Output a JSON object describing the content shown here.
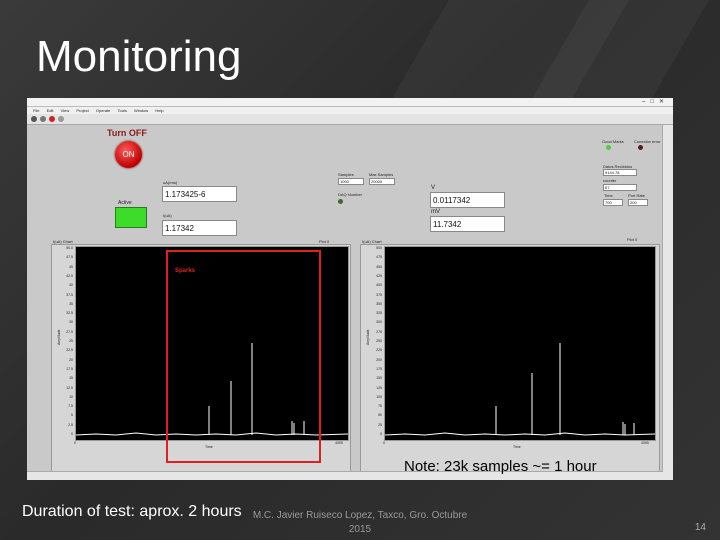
{
  "slide": {
    "title": "Monitoring",
    "note": "Note: 23k samples ~= 1 hour",
    "duration": "Duration of test:  aprox. 2 hours",
    "footer_line1": "M.C. Javier Ruiseco Lopez, Taxco, Gro. Octubre",
    "footer_line2": "2015",
    "page_number": "14"
  },
  "app": {
    "menu": [
      "File",
      "Edit",
      "View",
      "Project",
      "Operate",
      "Tools",
      "Window",
      "Help"
    ],
    "turn_off_label": "Turn OFF",
    "on_button_label": "ON",
    "active_label": "Active",
    "ua_label": "uA(rms)",
    "ua_value": "1.173425-6",
    "ua_short_label": "I(uA)",
    "ua_short_value": "1.17342",
    "samples_label": "Samples",
    "samples_value": "1000",
    "max_samples_label": "Max Samples",
    "max_samples_value": "20000",
    "daq_label": "DAQ Number",
    "v_label": "V",
    "v_value": "0.0117342",
    "mv_label": "mV",
    "mv_value": "11.7342",
    "good_marks_label": "Good Marks",
    "conn_error_label": "Conexión error",
    "data_received_label": "Datos Recibidos",
    "data_received_value": "9144.78",
    "counter_label": "counter",
    "counter_value": "67",
    "time_label": "Time",
    "time_value": "700",
    "port_rate_label": "Port Rate",
    "port_rate_value": "200",
    "left_chart_title": "I(uA) Chart",
    "left_plot_label": "Plot 0",
    "right_chart_title": "I(uA) Chart",
    "right_plot_label": "Plot 0",
    "left_x_start": "0",
    "left_x_end": "4095",
    "right_x_start": "0",
    "right_x_end": "4095",
    "x_axis_label": "Time",
    "y_axis_label": "Amplitude",
    "sparks_label": "Sparks",
    "left_y_ticks": [
      "50.0",
      "47.5",
      "45",
      "42.5",
      "40",
      "37.5",
      "35",
      "32.5",
      "30",
      "27.5",
      "25",
      "22.5",
      "20",
      "17.5",
      "15",
      "12.5",
      "10",
      "7.5",
      "5",
      "2.5",
      "0"
    ],
    "right_y_ticks": [
      "500",
      "475",
      "450",
      "425",
      "400",
      "375",
      "350",
      "325",
      "300",
      "275",
      "250",
      "225",
      "200",
      "175",
      "150",
      "125",
      "100",
      "75",
      "50",
      "25",
      "0"
    ]
  }
}
